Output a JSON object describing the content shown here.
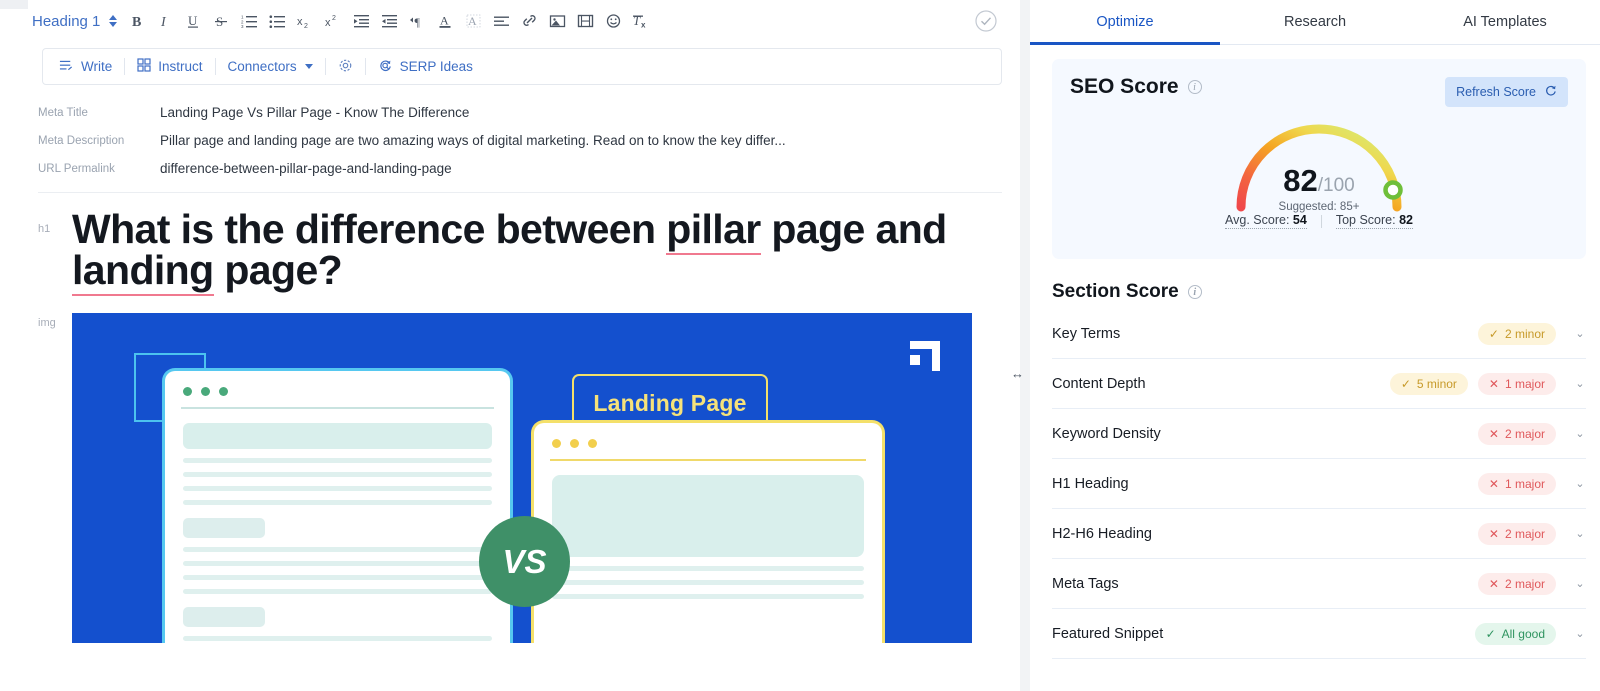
{
  "editor": {
    "heading_select": {
      "label": "Heading 1",
      "icon": "stepper-updown-icon"
    },
    "save_state_icon": "circle-check-icon",
    "format_tools": [
      {
        "name": "bold",
        "glyph": "B"
      },
      {
        "name": "italic",
        "glyph": "I"
      },
      {
        "name": "underline",
        "glyph": "U"
      },
      {
        "name": "strikethrough",
        "glyph": "S"
      },
      {
        "name": "ordered-list",
        "glyph": "1."
      },
      {
        "name": "bullet-list",
        "glyph": "•"
      },
      {
        "name": "subscript",
        "glyph": "x₂"
      },
      {
        "name": "superscript",
        "glyph": "x²"
      },
      {
        "name": "indent",
        "glyph": "→|"
      },
      {
        "name": "outdent",
        "glyph": "|←"
      },
      {
        "name": "text-direction",
        "glyph": "¶"
      },
      {
        "name": "text-color",
        "glyph": "A"
      },
      {
        "name": "highlight-color",
        "glyph": "A"
      },
      {
        "name": "align",
        "glyph": "≡"
      },
      {
        "name": "insert-link",
        "glyph": "🔗"
      },
      {
        "name": "insert-image",
        "glyph": "▣"
      },
      {
        "name": "insert-video",
        "glyph": "▤"
      },
      {
        "name": "insert-emoji",
        "glyph": "☺"
      },
      {
        "name": "clear-formatting",
        "glyph": "Tx"
      }
    ],
    "ai_toolbar": [
      {
        "label": "Write",
        "icon": "write-icon"
      },
      {
        "label": "Instruct",
        "icon": "grid-icon"
      },
      {
        "label": "Connectors",
        "icon": "chevron-down-icon"
      },
      {
        "label": "",
        "icon": "gear-icon"
      },
      {
        "label": "SERP Ideas",
        "icon": "refresh-search-icon"
      }
    ],
    "meta": [
      {
        "label": "Meta Title",
        "value": "Landing Page Vs Pillar Page - Know The Difference"
      },
      {
        "label": "Meta Description",
        "value": "Pillar page and landing page are two amazing ways of digital marketing. Read on to know the key differ..."
      },
      {
        "label": "URL Permalink",
        "value": "difference-between-pillar-page-and-landing-page"
      }
    ],
    "h1": {
      "gutter_label": "h1",
      "parts": [
        {
          "text": "What is the difference between ",
          "flag": false
        },
        {
          "text": "pillar",
          "flag": true
        },
        {
          "text": " page and ",
          "flag": false
        },
        {
          "text": "landing",
          "flag": true
        },
        {
          "text": " page?",
          "flag": false
        }
      ]
    },
    "image_block": {
      "gutter_label": "img",
      "background_color": "#1450ce",
      "vs_label": "VS",
      "right_caption": "Landing Page",
      "accent_cyan": "#4cc3ef",
      "accent_yellow": "#f4e06a"
    },
    "splitter_icon": "resize-horizontal-icon"
  },
  "panel": {
    "tabs": [
      {
        "label": "Optimize",
        "active": true
      },
      {
        "label": "Research",
        "active": false
      },
      {
        "label": "AI Templates",
        "active": false
      }
    ],
    "seo_score": {
      "title": "SEO Score",
      "info_icon": "info-icon",
      "refresh_label": "Refresh Score",
      "refresh_icon": "refresh-icon",
      "score": "82",
      "denominator": "/100",
      "suggested": "Suggested: 85+",
      "avg_label": "Avg. Score:",
      "avg_value": "54",
      "top_label": "Top Score:",
      "top_value": "82",
      "marker_color": "#6fbf3a",
      "gradient_start": "#f0484a",
      "gradient_mid": "#f5a623",
      "gradient_end": "#d8e56a"
    },
    "section_score": {
      "title": "Section Score",
      "info_icon": "info-icon",
      "rows": [
        {
          "name": "Key Terms",
          "badges": [
            {
              "kind": "minor",
              "text": "2 minor",
              "icon": "check-icon"
            }
          ]
        },
        {
          "name": "Content Depth",
          "badges": [
            {
              "kind": "minor",
              "text": "5 minor",
              "icon": "check-icon"
            },
            {
              "kind": "major",
              "text": "1 major",
              "icon": "x-icon"
            }
          ]
        },
        {
          "name": "Keyword Density",
          "badges": [
            {
              "kind": "major",
              "text": "2 major",
              "icon": "x-icon"
            }
          ]
        },
        {
          "name": "H1 Heading",
          "badges": [
            {
              "kind": "major",
              "text": "1 major",
              "icon": "x-icon"
            }
          ]
        },
        {
          "name": "H2-H6 Heading",
          "badges": [
            {
              "kind": "major",
              "text": "2 major",
              "icon": "x-icon"
            }
          ]
        },
        {
          "name": "Meta Tags",
          "badges": [
            {
              "kind": "major",
              "text": "2 major",
              "icon": "x-icon"
            }
          ]
        },
        {
          "name": "Featured Snippet",
          "badges": [
            {
              "kind": "good",
              "text": "All good",
              "icon": "double-check-icon"
            }
          ]
        }
      ]
    }
  }
}
